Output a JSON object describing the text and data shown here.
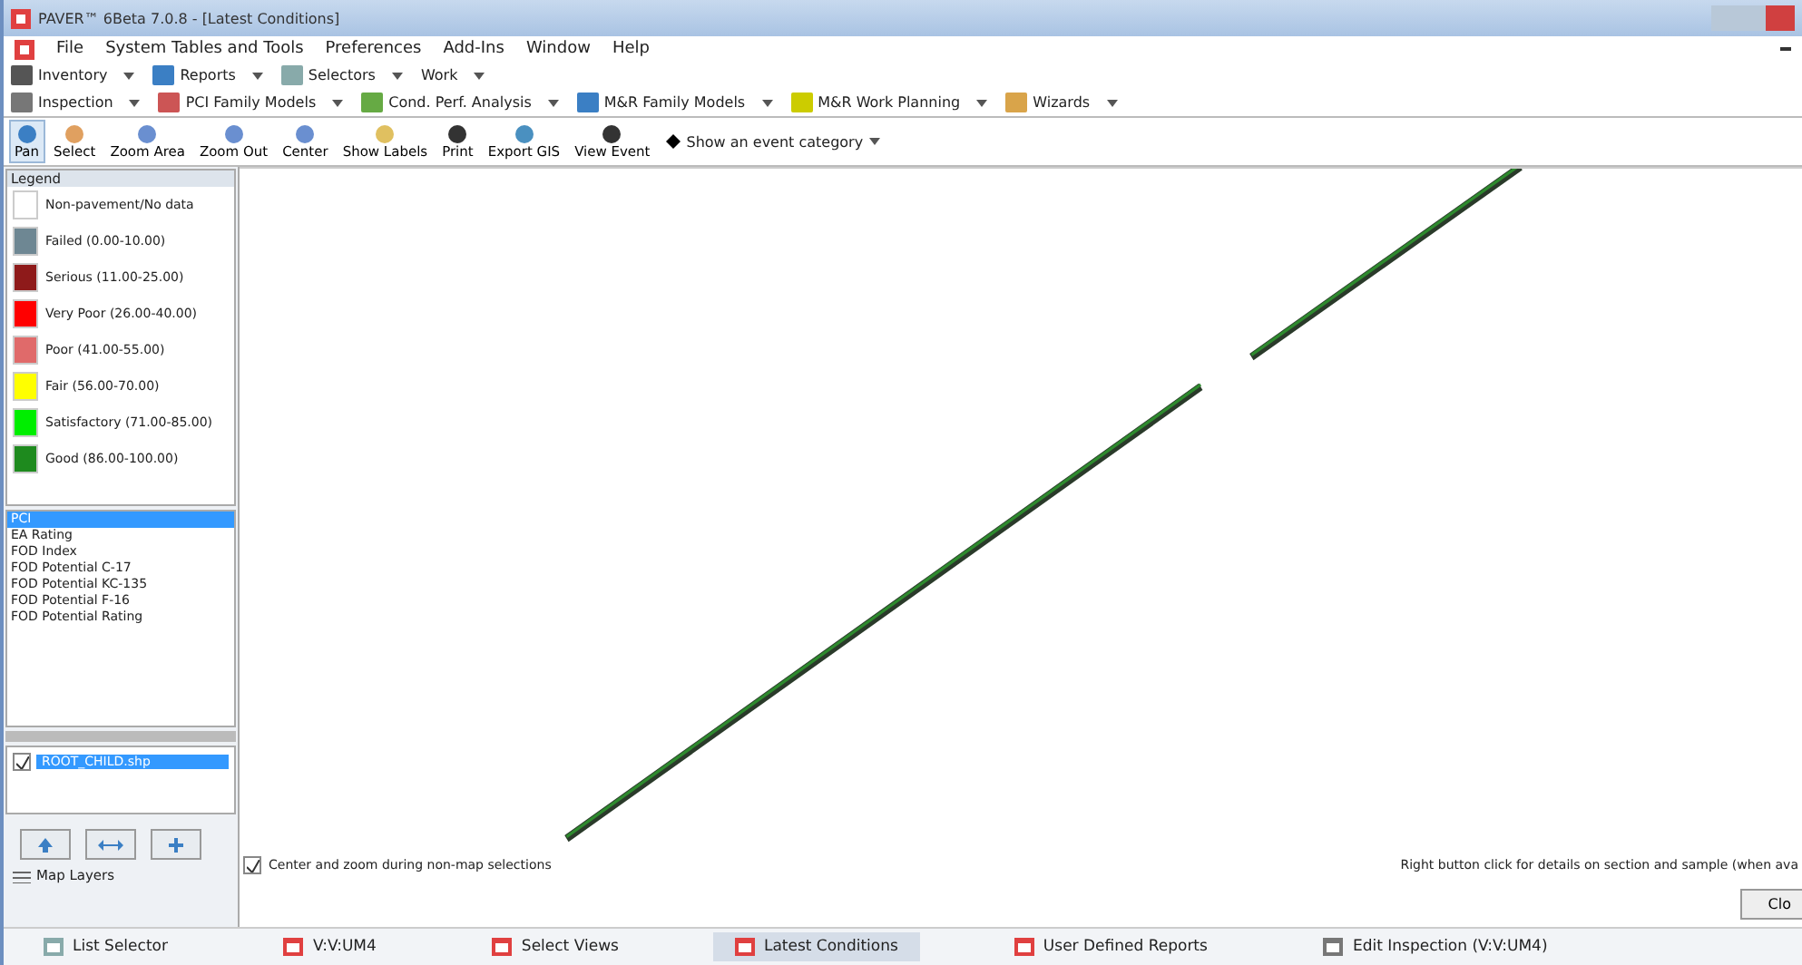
{
  "window": {
    "title": "PAVER™ 6Beta 7.0.8 - [Latest Conditions]"
  },
  "menu": [
    "File",
    "System Tables and Tools",
    "Preferences",
    "Add-Ins",
    "Window",
    "Help"
  ],
  "toolbar_1": [
    "Inventory",
    "Reports",
    "Selectors",
    "Work"
  ],
  "toolbar_2": [
    "Inspection",
    "PCI Family Models",
    "Cond. Perf. Analysis",
    "M&R Family Models",
    "M&R Work Planning",
    "Wizards"
  ],
  "tools": [
    {
      "label": "Pan",
      "selected": true
    },
    {
      "label": "Select",
      "selected": false
    },
    {
      "label": "Zoom Area",
      "selected": false
    },
    {
      "label": "Zoom Out",
      "selected": false
    },
    {
      "label": "Center",
      "selected": false
    },
    {
      "label": "Show Labels",
      "selected": false
    },
    {
      "label": "Print",
      "selected": false
    },
    {
      "label": "Export GIS",
      "selected": false
    },
    {
      "label": "View Event",
      "selected": false
    }
  ],
  "event_dropdown": {
    "label": "Show an event category"
  },
  "legend": {
    "title": "Legend",
    "items": [
      {
        "label": "Non-pavement/No data",
        "color": "#ffffff"
      },
      {
        "label": "Failed (0.00-10.00)",
        "color": "#6e8793"
      },
      {
        "label": "Serious (11.00-25.00)",
        "color": "#8e1a1a"
      },
      {
        "label": "Very Poor (26.00-40.00)",
        "color": "#ff0000"
      },
      {
        "label": "Poor (41.00-55.00)",
        "color": "#e06a6a"
      },
      {
        "label": "Fair (56.00-70.00)",
        "color": "#ffff00"
      },
      {
        "label": "Satisfactory (71.00-85.00)",
        "color": "#00ee00"
      },
      {
        "label": "Good (86.00-100.00)",
        "color": "#1e8a1e"
      }
    ]
  },
  "index_list": [
    {
      "label": "PCI",
      "selected": true
    },
    {
      "label": "EA Rating",
      "selected": false
    },
    {
      "label": "FOD Index",
      "selected": false
    },
    {
      "label": "FOD Potential C-17",
      "selected": false
    },
    {
      "label": "FOD Potential KC-135",
      "selected": false
    },
    {
      "label": "FOD Potential F-16",
      "selected": false
    },
    {
      "label": "FOD Potential Rating",
      "selected": false
    }
  ],
  "layers": [
    {
      "label": "ROOT_CHILD.shp",
      "checked": true
    }
  ],
  "map_layers_label": "Map Layers",
  "center_zoom": {
    "label": "Center and zoom during non-map selections",
    "checked": true
  },
  "hint": "Right button click for details on section and sample (when ava",
  "close_button": "Clo",
  "tabs": [
    {
      "label": "List Selector",
      "selected": false
    },
    {
      "label": "V:V:UM4",
      "selected": false
    },
    {
      "label": "Select Views",
      "selected": false
    },
    {
      "label": "Latest Conditions",
      "selected": true
    },
    {
      "label": "User Defined Reports",
      "selected": false
    },
    {
      "label": "Edit Inspection (V:V:UM4)",
      "selected": false
    }
  ]
}
